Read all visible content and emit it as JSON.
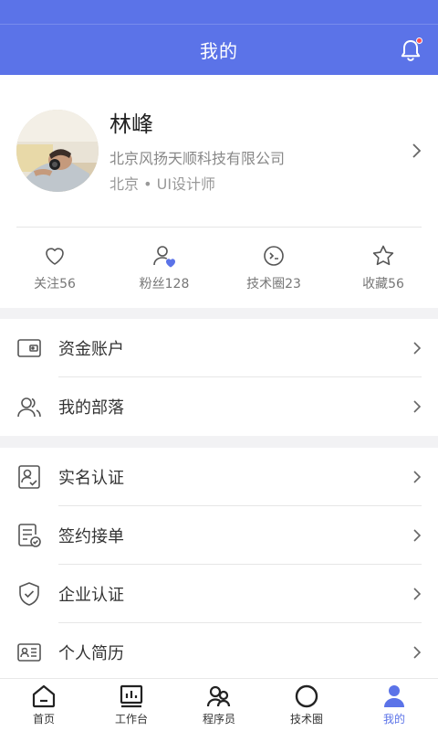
{
  "colors": {
    "accent": "#5b73e8",
    "badge": "#ff4d4f"
  },
  "header": {
    "title": "我的"
  },
  "profile": {
    "name": "林峰",
    "company": "北京风扬天顺科技有限公司",
    "location": "北京 • UI设计师"
  },
  "stats": [
    {
      "label": "关注56",
      "icon": "heart-icon"
    },
    {
      "label": "粉丝128",
      "icon": "fans-icon"
    },
    {
      "label": "技术圈23",
      "icon": "tech-circle-icon"
    },
    {
      "label": "收藏56",
      "icon": "star-icon"
    }
  ],
  "menu": {
    "group1": [
      {
        "label": "资金账户",
        "icon": "wallet-icon"
      },
      {
        "label": "我的部落",
        "icon": "group-icon"
      }
    ],
    "group2": [
      {
        "label": "实名认证",
        "icon": "id-verify-icon"
      },
      {
        "label": "签约接单",
        "icon": "contract-icon"
      },
      {
        "label": "企业认证",
        "icon": "shield-icon"
      },
      {
        "label": "个人简历",
        "icon": "resume-icon"
      }
    ]
  },
  "tabs": [
    {
      "label": "首页",
      "icon": "home-icon"
    },
    {
      "label": "工作台",
      "icon": "dashboard-icon"
    },
    {
      "label": "程序员",
      "icon": "programmers-icon"
    },
    {
      "label": "技术圈",
      "icon": "circle-icon"
    },
    {
      "label": "我的",
      "icon": "user-icon",
      "active": true
    }
  ]
}
